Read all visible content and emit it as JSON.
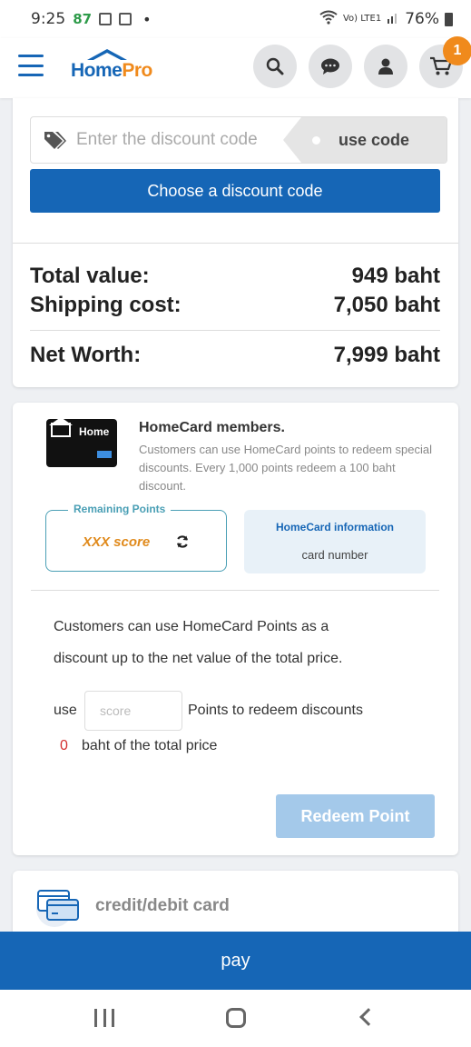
{
  "status_bar": {
    "time": "9:25",
    "notification_count": "87",
    "signal_text": "Vo) LTE1",
    "battery": "76%"
  },
  "header": {
    "logo_home": "Home",
    "logo_pro": "Pro",
    "cart_badge": "1"
  },
  "discount": {
    "placeholder": "Enter the discount code",
    "use_code_label": "use code",
    "choose_label": "Choose a discount code"
  },
  "summary": {
    "total_label": "Total value:",
    "total_value": "949 baht",
    "shipping_label": "Shipping cost:",
    "shipping_value": "7,050 baht",
    "net_label": "Net Worth:",
    "net_value": "7,999 baht"
  },
  "homecard": {
    "card_text": "Home",
    "title": "HomeCard members.",
    "description": "Customers can use HomeCard points to redeem special discounts. Every 1,000 points redeem a 100 baht discount.",
    "remaining_label": "Remaining Points",
    "remaining_value": "XXX score",
    "info_title": "HomeCard information",
    "info_sub": "card number",
    "usage_line1": "Customers can use HomeCard Points as a",
    "usage_line2": "discount up to the net value of the total price.",
    "use_label": "use",
    "score_placeholder": "score",
    "redeem_text": "Points to redeem discounts",
    "discount_amount": "0",
    "baht_text": "baht of the total price",
    "redeem_button": "Redeem Point"
  },
  "payment": {
    "credit_label": "credit/debit card",
    "pay_label": "pay"
  },
  "colors": {
    "brand_blue": "#1666b6",
    "brand_orange": "#f08a1c",
    "redeem_disabled": "#a4c9ea"
  }
}
